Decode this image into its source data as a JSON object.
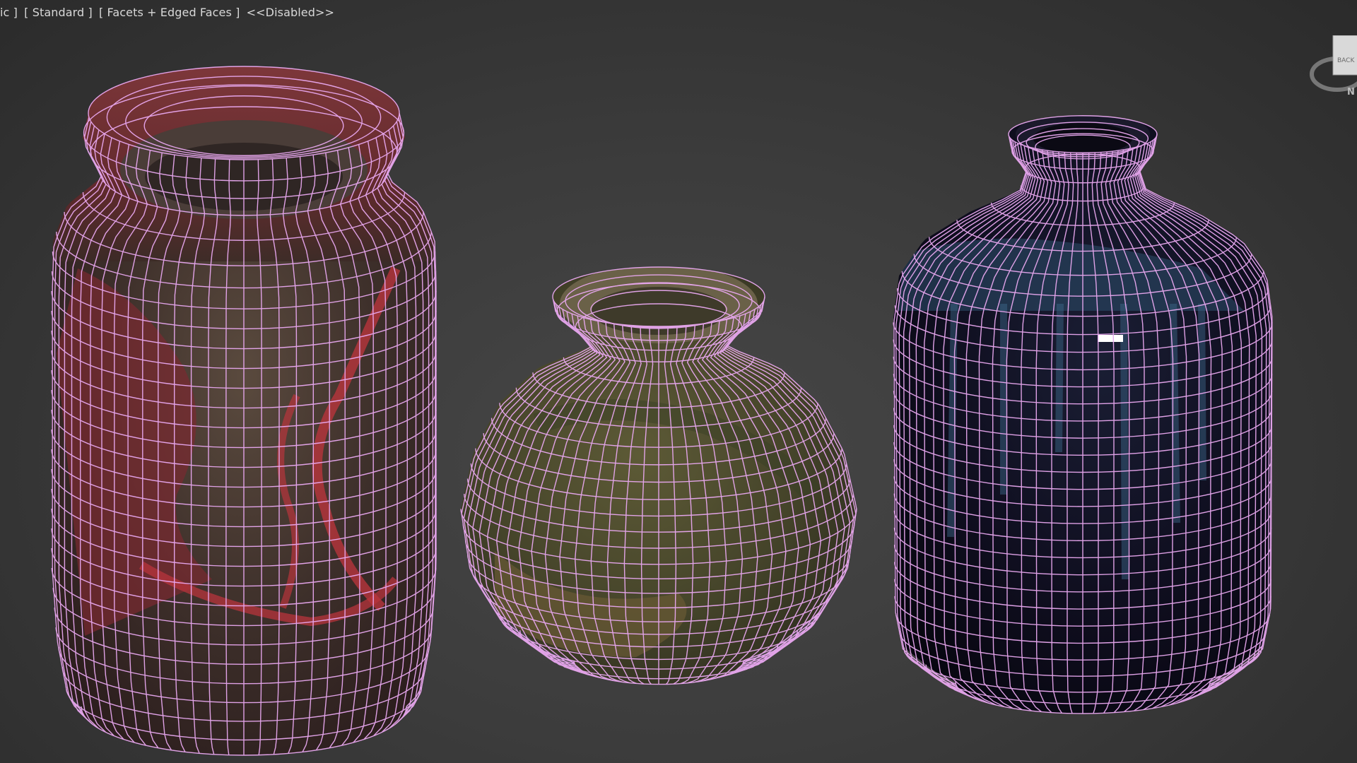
{
  "viewport": {
    "label_items": [
      "ic ]",
      "[ Standard ]",
      "[ Facets + Edged Faces ]",
      "<<Disabled>>"
    ],
    "background_color": "#3a3a3a",
    "wire_color": "#e9a8f0"
  },
  "viewcube": {
    "icon": "viewcube-icon",
    "face_label": "BACK",
    "compass_label": "N"
  },
  "objects": [
    {
      "name": "tall-red-jar",
      "base_color": "#6b2a2a",
      "accent_color": "#c0353d"
    },
    {
      "name": "round-green-vase",
      "base_color": "#4a4a2c",
      "accent_color": "#6a5d35"
    },
    {
      "name": "dark-blue-bottle",
      "base_color": "#0e0d1c",
      "accent_color": "#2c5a7a"
    }
  ]
}
